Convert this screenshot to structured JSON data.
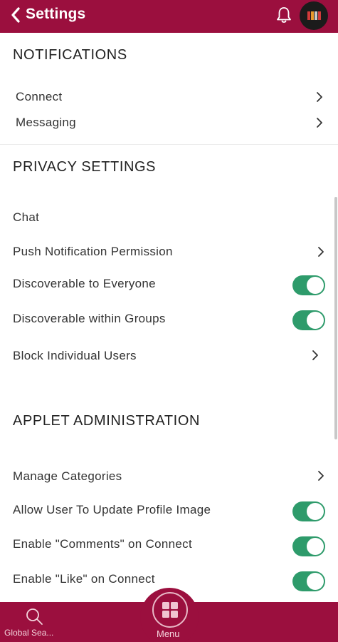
{
  "header": {
    "title": "Settings",
    "back_icon": "chevron-left-icon",
    "bell_icon": "bell-icon",
    "brand_color": "#9b0f3e"
  },
  "notifications": {
    "title": "NOTIFICATIONS",
    "items": [
      {
        "label": "Connect"
      },
      {
        "label": "Messaging"
      }
    ]
  },
  "privacy": {
    "title": "PRIVACY SETTINGS",
    "chat_label": "Chat",
    "push_label": "Push Notification Permission",
    "discoverable_everyone_label": "Discoverable to Everyone",
    "discoverable_everyone_on": true,
    "discoverable_groups_label": "Discoverable within Groups",
    "discoverable_groups_on": true,
    "block_label": "Block Individual Users"
  },
  "applet": {
    "title": "APPLET ADMINISTRATION",
    "manage_categories_label": "Manage Categories",
    "allow_profile_label": "Allow User To Update Profile Image",
    "allow_profile_on": true,
    "enable_comments_label": "Enable \"Comments\" on Connect",
    "enable_comments_on": true,
    "enable_like_label": "Enable \"Like\" on Connect",
    "enable_like_on": true
  },
  "bottom_nav": {
    "search_label": "Global Sea...",
    "menu_label": "Menu",
    "toggle_color": "#2e9b6b"
  }
}
